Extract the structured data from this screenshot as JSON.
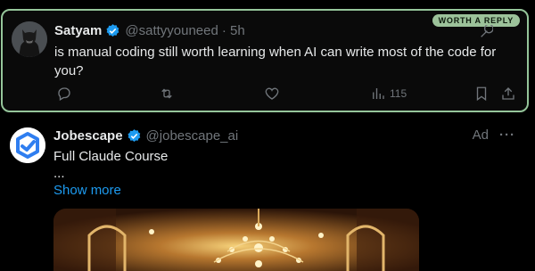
{
  "tweet1": {
    "badge": "WORTH A REPLY",
    "name": "Satyam",
    "handle": "@sattyyouneed",
    "time": "· 5h",
    "text": "is manual coding still worth learning when AI can write most of the code for you?",
    "actions": {
      "views_count": "115"
    },
    "icons": [
      "reply-icon",
      "retweet-icon",
      "like-icon",
      "views-icon",
      "bookmark-icon",
      "share-icon",
      "more-icon"
    ]
  },
  "tweet2": {
    "name": "Jobescape",
    "handle": "@jobescape_ai",
    "ad_label": "Ad",
    "more": "···",
    "line1": "Full Claude Course",
    "line2": "...",
    "show_more": "Show more"
  },
  "colors": {
    "background": "#000000",
    "highlight_border": "#95c59a",
    "verified": "#1d9bf0",
    "link": "#1d9bf0",
    "muted": "#71767b"
  }
}
